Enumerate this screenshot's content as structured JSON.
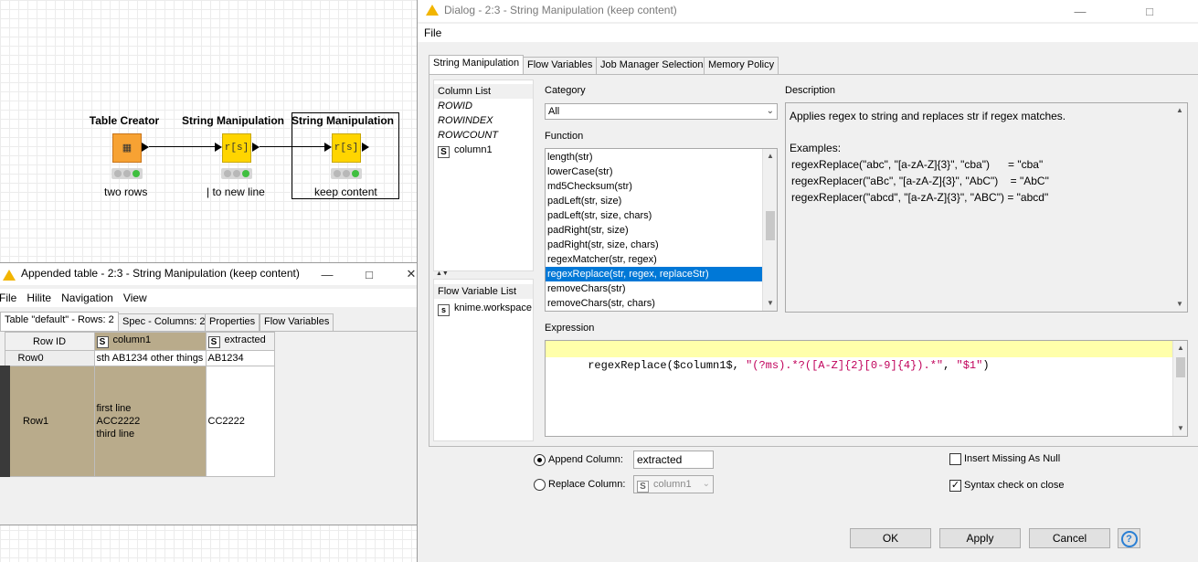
{
  "workflow": {
    "nodes": [
      {
        "title": "Table Creator",
        "label": "two rows",
        "icon_text": "▦",
        "icon": "table-creator-icon",
        "color": "#f7a233"
      },
      {
        "title": "String Manipulation",
        "label": "| to new line",
        "icon_text": "r[s]",
        "icon": "string-manipulation-icon",
        "color": "#ffd500"
      },
      {
        "title": "String Manipulation",
        "label": "keep content",
        "icon_text": "r[s]",
        "icon": "string-manipulation-icon",
        "color": "#ffd500"
      }
    ]
  },
  "table_window": {
    "title": "Appended table - 2:3 - String Manipulation (keep content)",
    "menu": [
      "File",
      "Hilite",
      "Navigation",
      "View"
    ],
    "tabs": [
      "Table \"default\" - Rows: 2",
      "Spec - Columns: 2",
      "Properties",
      "Flow Variables"
    ],
    "columns": {
      "row_id": "Row ID",
      "col1_type": "S",
      "col1": "column1",
      "col2_type": "S",
      "col2": "extracted"
    },
    "rows": [
      {
        "id": "Row0",
        "column1": [
          "sth AB1234 other things"
        ],
        "extracted": "AB1234"
      },
      {
        "id": "Row1",
        "column1": [
          "first line",
          "ACC2222",
          "third line"
        ],
        "extracted": "CC2222"
      }
    ]
  },
  "dialog": {
    "title": "Dialog - 2:3 - String Manipulation (keep content)",
    "menu": [
      "File"
    ],
    "tabs": [
      "String Manipulation",
      "Flow Variables",
      "Job Manager Selection",
      "Memory Policy"
    ],
    "column_list": {
      "header": "Column List",
      "items": [
        "ROWID",
        "ROWINDEX",
        "ROWCOUNT"
      ],
      "column_type": "S",
      "column": "column1"
    },
    "flow_variable_list": {
      "header": "Flow Variable List",
      "item": "knime.workspace"
    },
    "category": {
      "label": "Category",
      "value": "All"
    },
    "function": {
      "label": "Function",
      "items": [
        "length(str)",
        "lowerCase(str)",
        "md5Checksum(str)",
        "padLeft(str, size)",
        "padLeft(str, size, chars)",
        "padRight(str, size)",
        "padRight(str, size, chars)",
        "regexMatcher(str, regex)",
        "regexReplace(str, regex, replaceStr)",
        "removeChars(str)",
        "removeChars(str, chars)"
      ],
      "selected_index": 8
    },
    "description": {
      "label": "Description",
      "text": "Applies regex to string and replaces str if regex matches.",
      "examples_label": "Examples:",
      "examples": [
        "regexReplace(\"abc\", \"[a-zA-Z]{3}\", \"cba\")      = \"cba\"",
        "regexReplacer(\"aBc\", \"[a-zA-Z]{3}\", \"AbC\")    = \"AbC\"",
        "regexReplacer(\"abcd\", \"[a-zA-Z]{3}\", \"ABC\") = \"abcd\""
      ]
    },
    "expression": {
      "label": "Expression",
      "fn": "regexReplace(",
      "col": "$column1$",
      "sep1": ", ",
      "regex": "\"(?ms).*?([A-Z]{2}[0-9]{4}).*\"",
      "sep2": ", ",
      "repl": "\"$1\"",
      "close": ")"
    },
    "append_label": "Append Column:",
    "append_value": "extracted",
    "replace_label": "Replace Column:",
    "replace_value": "column1",
    "replace_type": "S",
    "insert_missing_label": "Insert Missing As Null",
    "syntax_check_label": "Syntax check on close",
    "buttons": {
      "ok": "OK",
      "apply": "Apply",
      "cancel": "Cancel",
      "help": "?"
    }
  }
}
